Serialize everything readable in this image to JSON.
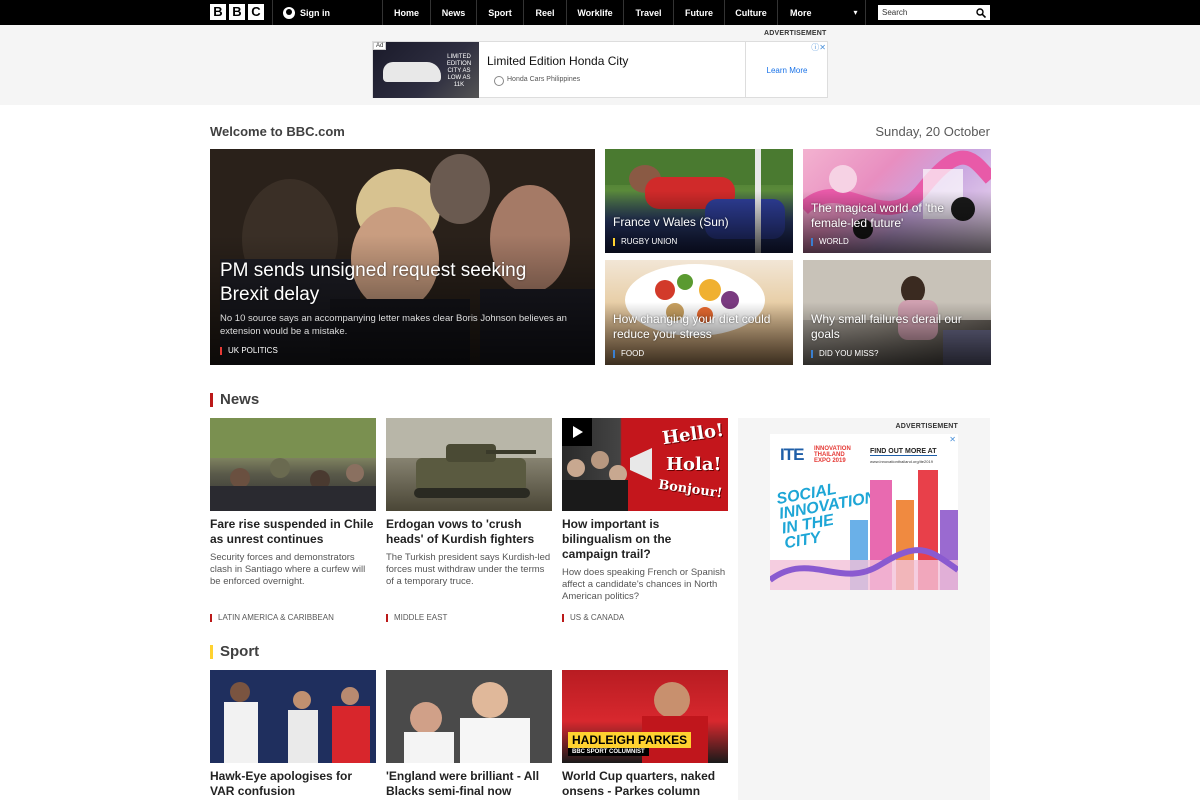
{
  "nav": {
    "logo_letters": [
      "B",
      "B",
      "C"
    ],
    "signin_label": "Sign in",
    "items": [
      {
        "label": "Home",
        "w": 48
      },
      {
        "label": "News",
        "w": 46
      },
      {
        "label": "Sport",
        "w": 47
      },
      {
        "label": "Reel",
        "w": 43
      },
      {
        "label": "Worklife",
        "w": 57
      },
      {
        "label": "Travel",
        "w": 50
      },
      {
        "label": "Future",
        "w": 51
      },
      {
        "label": "Culture",
        "w": 53
      }
    ],
    "more_label": "More",
    "more_caret": "▾",
    "search_placeholder": "Search"
  },
  "top_ad": {
    "label": "ADVERTISEMENT",
    "chip": "Ad",
    "image_text": "LIMITED EDITION CITY AS LOW AS 11K",
    "title": "Limited Edition Honda City",
    "sponsor": "Honda Cars Philippines",
    "cta": "Learn More",
    "close": "ⓘ✕"
  },
  "welcome": {
    "title": "Welcome to BBC.com",
    "date": "Sunday, 20 October"
  },
  "hero": {
    "title": "PM sends unsigned request seeking Brexit delay",
    "summary": "No 10 source says an accompanying letter makes clear Boris Johnson believes an extension would be a mistake.",
    "tag": "UK POLITICS"
  },
  "tiles": [
    {
      "title": "France v Wales (Sun)",
      "tag": "RUGBY UNION"
    },
    {
      "title": "The magical world of 'the female-led future'",
      "tag": "WORLD"
    },
    {
      "title": "How changing your diet could reduce your stress",
      "tag": "FOOD"
    },
    {
      "title": "Why small failures derail our goals",
      "tag": "DID YOU MISS?"
    }
  ],
  "news": {
    "heading": "News",
    "cards": [
      {
        "title": "Fare rise suspended in Chile as unrest continues",
        "summary": "Security forces and demonstrators clash in Santiago where a curfew will be enforced overnight.",
        "category": "LATIN AMERICA & CARIBBEAN"
      },
      {
        "title": "Erdogan vows to 'crush heads' of Kurdish fighters",
        "summary": "The Turkish president says Kurdish-led forces must withdraw under the terms of a temporary truce.",
        "category": "MIDDLE EAST"
      },
      {
        "title": "How important is bilingualism on the campaign trail?",
        "summary": "How does speaking French or Spanish affect a candidate's chances in North American politics?",
        "category": "US & CANADA"
      }
    ],
    "hello_words": [
      "Hello!",
      "Hola!",
      "Bonjour!"
    ]
  },
  "sport": {
    "heading": "Sport",
    "cards": [
      {
        "title": "Hawk-Eye apologises for VAR confusion"
      },
      {
        "title": "'England were brilliant - All Blacks semi-final now"
      },
      {
        "title": "World Cup quarters, naked onsens - Parkes column"
      }
    ],
    "parkes_banner": "HADLEIGH PARKES",
    "parkes_sub": "BBC SPORT COLUMNIST"
  },
  "right_ad": {
    "label": "ADVERTISEMENT",
    "logo": "ITE",
    "logo_sub": "INNOVATION THAILAND EXPO 2019",
    "find": "FIND OUT MORE AT",
    "url": "www.innovationthailand.org/ite2019",
    "headline": "SOCIAL INNOVATION IN THE CITY",
    "close": "✕"
  }
}
